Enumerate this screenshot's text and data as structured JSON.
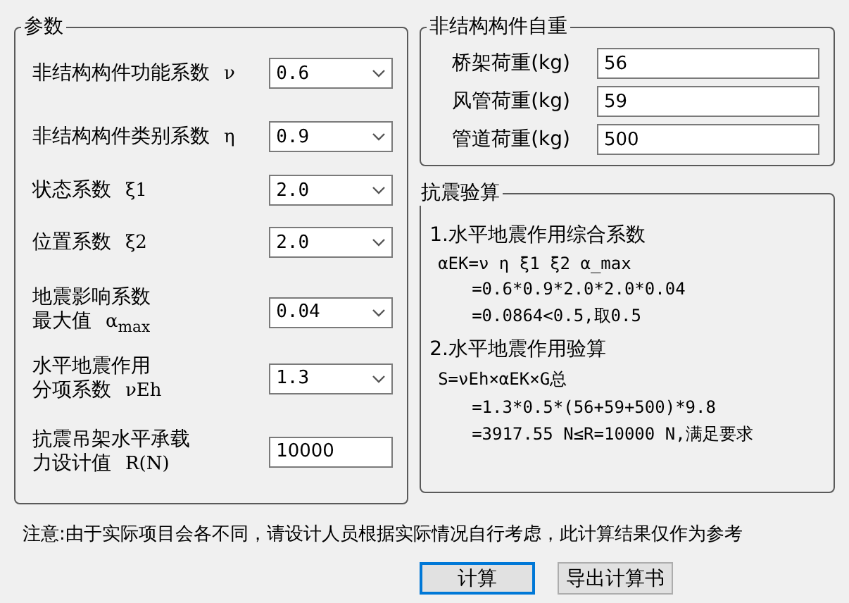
{
  "params": {
    "title": "参数",
    "rows": [
      {
        "kind": "combo",
        "label": [
          "非结构构件功能系数"
        ],
        "symbol": "ν",
        "value": "0.6"
      },
      {
        "kind": "combo",
        "label": [
          "非结构构件类别系数"
        ],
        "symbol": "η",
        "value": "0.9"
      },
      {
        "kind": "combo",
        "label": [
          "状态系数"
        ],
        "symbol": "ξ1",
        "value": "2.0"
      },
      {
        "kind": "combo",
        "label": [
          "位置系数"
        ],
        "symbol": "ξ2",
        "value": "2.0"
      },
      {
        "kind": "combo",
        "label": [
          "地震影响系数",
          "最大值"
        ],
        "symbol": "α$_{max}$",
        "value": "0.04"
      },
      {
        "kind": "combo",
        "label": [
          "水平地震作用",
          "分项系数"
        ],
        "symbol": "νEh",
        "value": "1.3"
      },
      {
        "kind": "input",
        "label": [
          "抗震吊架水平承载",
          "力设计值"
        ],
        "symbol": "R(N)",
        "value": "10000"
      }
    ]
  },
  "weights": {
    "title": "非结构构件自重",
    "rows": [
      {
        "label": "桥架荷重(kg)",
        "value": "56"
      },
      {
        "label": "风管荷重(kg)",
        "value": "59"
      },
      {
        "label": "管道荷重(kg)",
        "value": "500"
      }
    ]
  },
  "check": {
    "title": "抗震验算",
    "lines": [
      {
        "kind": "heading",
        "text": "1.水平地震作用综合系数"
      },
      {
        "kind": "formula",
        "text": "αEK=ν η ξ1 ξ2 α_max"
      },
      {
        "kind": "step",
        "text": "=0.6*0.9*2.0*2.0*0.04"
      },
      {
        "kind": "step",
        "text": "=0.0864<0.5,取0.5"
      },
      {
        "kind": "heading",
        "text": "2.水平地震作用验算"
      },
      {
        "kind": "formula",
        "text": "S=νEh×αEK×G总"
      },
      {
        "kind": "step",
        "text": "=1.3*0.5*(56+59+500)*9.8"
      },
      {
        "kind": "step",
        "text": "=3917.55 N≤R=10000 N,满足要求"
      }
    ]
  },
  "note": "注意:由于实际项目会各不同，请设计人员根据实际情况自行考虑，此计算结果仅作为参考",
  "buttons": [
    {
      "label": "计算",
      "focused": true
    },
    {
      "label": "导出计算书",
      "focused": false
    }
  ]
}
